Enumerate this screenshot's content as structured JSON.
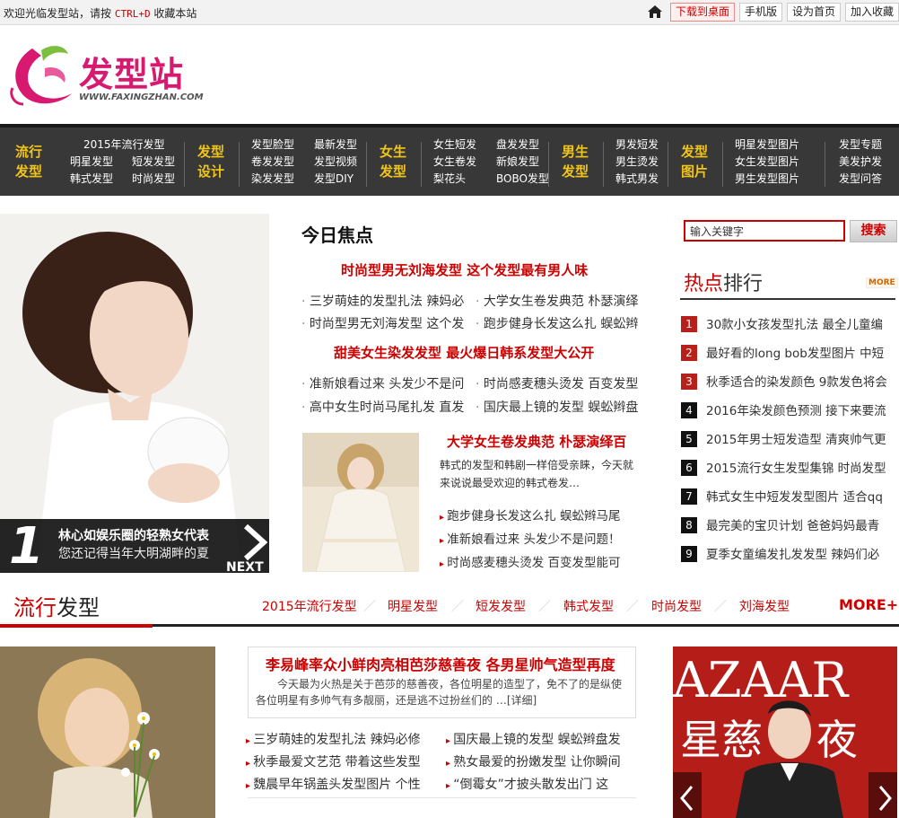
{
  "topbar": {
    "welcome_pre": "欢迎光临发型站，请按",
    "welcome_key": "CTRL+D",
    "welcome_post": "收藏本站",
    "buttons": [
      "下载到桌面",
      "手机版",
      "设为首页",
      "加入收藏"
    ]
  },
  "logo": {
    "cn": "发型站",
    "en": "WWW.FAXINGZHAN.COM"
  },
  "nav": {
    "groups": [
      {
        "heading": [
          "流行",
          "发型"
        ],
        "cols": [
          [
            "2015年流行发型"
          ],
          [
            "明星发型",
            "韩式发型"
          ],
          [
            "短发发型",
            "时尚发型"
          ]
        ]
      },
      {
        "heading": [
          "发型",
          "设计"
        ],
        "cols": [
          [
            "发型脸型",
            "卷发发型",
            "染发发型"
          ],
          [
            "最新发型",
            "发型视频",
            "发型DIY"
          ]
        ]
      },
      {
        "heading": [
          "女生",
          "发型"
        ],
        "cols": [
          [
            "女生短发",
            "女生卷发",
            "梨花头"
          ],
          [
            "盘发发型",
            "新娘发型",
            "BOBO发型"
          ]
        ]
      },
      {
        "heading": [
          "男生",
          "发型"
        ],
        "cols": [
          [
            "男发短发",
            "男生烫发",
            "韩式男发"
          ]
        ]
      },
      {
        "heading": [
          "发型",
          "图片"
        ],
        "cols": [
          [
            "明星发型图片",
            "女生发型图片",
            "男生发型图片"
          ]
        ]
      },
      {
        "heading": [],
        "cols": [
          [
            "发型专题",
            "美发护发",
            "发型问答"
          ]
        ]
      }
    ]
  },
  "hero": {
    "number": "1",
    "title": "林心如娱乐圈的轻熟女代表",
    "subtitle": "您还记得当年大明湖畔的夏",
    "next": "NEXT"
  },
  "focus": {
    "title": "今日焦点",
    "headline1": "时尚型男无刘海发型 这个发型最有男人味",
    "rows1": [
      [
        "三岁萌娃的发型扎法 辣妈必",
        "大学女生卷发典范 朴瑟演绎"
      ],
      [
        "时尚型男无刘海发型 这个发",
        "跑步健身长发这么扎 蜈蚣辫"
      ]
    ],
    "headline2": "甜美女生染发发型 最火爆日韩系发型大公开",
    "rows2": [
      [
        "准新娘看过来 头发少不是问",
        "时尚感麦穗头烫发 百变发型"
      ],
      [
        "高中女生时尚马尾扎发 直发",
        "国庆最上镜的发型 蜈蚣辫盘"
      ]
    ],
    "sub_title": "大学女生卷发典范 朴瑟演绎百",
    "sub_desc": "韩式的发型和韩剧一样倍受亲睐，今天就来说说最受欢迎的韩式卷发…",
    "sub_links": [
      "跑步健身长发这么扎 蜈蚣辫马尾",
      "准新娘看过来 头发少不是问题！",
      "时尚感麦穗头烫发 百变发型能可"
    ]
  },
  "search": {
    "placeholder": "输入关键字",
    "button": "搜索"
  },
  "ranking": {
    "title_a": "热点",
    "title_b": "排行",
    "more": "MORE",
    "items": [
      {
        "n": "1",
        "text": "30款小女孩发型扎法 最全儿童编"
      },
      {
        "n": "2",
        "text": "最好看的long bob发型图片 中短"
      },
      {
        "n": "3",
        "text": "秋季适合的染发颜色 9款发色将会"
      },
      {
        "n": "4",
        "text": "2016年染发颜色预测 接下来要流"
      },
      {
        "n": "5",
        "text": "2015年男士短发造型 清爽帅气更"
      },
      {
        "n": "6",
        "text": "2015流行女生发型集锦 时尚发型"
      },
      {
        "n": "7",
        "text": "韩式女生中短发发型图片 适合qq"
      },
      {
        "n": "8",
        "text": "最完美的宝贝计划 爸爸妈妈最青"
      },
      {
        "n": "9",
        "text": "夏季女童编发扎发发型 辣妈们必"
      }
    ]
  },
  "section": {
    "title_a": "流行",
    "title_b": "发型",
    "nav": [
      "2015年流行发型",
      "明星发型",
      "短发发型",
      "韩式发型",
      "时尚发型",
      "刘海发型"
    ],
    "more": "MORE+",
    "news_title": "李易峰率众小鲜肉亮相芭莎慈善夜 各男星帅气造型再度",
    "news_desc": "今天最为火热是关于芭莎的慈善夜，各位明星的造型了，免不了的是纵使各位明星有多帅气有多靓丽，还是逃不过扮丝们的 …",
    "news_detail": "[详细]",
    "links_left": [
      "三岁萌娃的发型扎法 辣妈必修",
      "秋季最爱文艺范 带着这些发型",
      "魏晨早年锅盖头发型图片 个性"
    ],
    "links_right": [
      "国庆最上镜的发型 蜈蚣辫盘发",
      "熟女最爱的扮嫩发型 让你瞬间",
      "“倒霉女”才披头散发出门 这"
    ],
    "star_banner": "星慈",
    "star_banner2": "夜",
    "star_brand": "AZAAR"
  }
}
